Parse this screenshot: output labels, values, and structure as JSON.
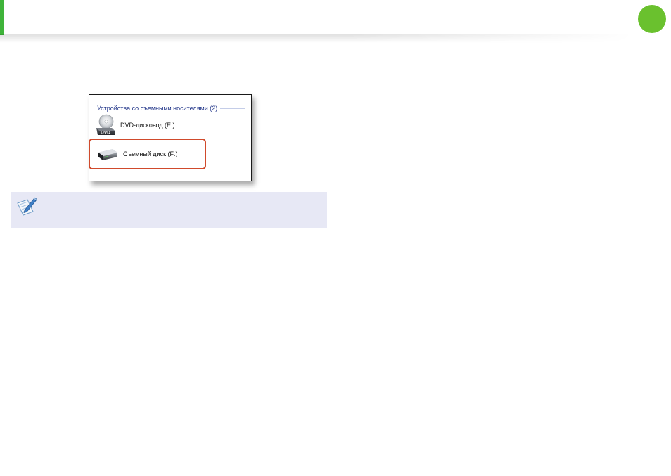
{
  "screenshot": {
    "group_header": "Устройства со съемными носителями (2)",
    "drives": [
      {
        "label": "DVD-дисковод (E:)",
        "icon": "dvd-drive-icon",
        "badge": "DVD"
      },
      {
        "label": "Съемный диск (F:)",
        "icon": "removable-disk-icon",
        "highlighted": true
      }
    ]
  },
  "note": {
    "icon": "note-pen-icon"
  },
  "colors": {
    "accent": "#3fb43a",
    "page_dot": "#6ac12e",
    "highlight": "#d04a2c",
    "note_bg": "#e7e8f5",
    "group_header": "#1e3287"
  }
}
